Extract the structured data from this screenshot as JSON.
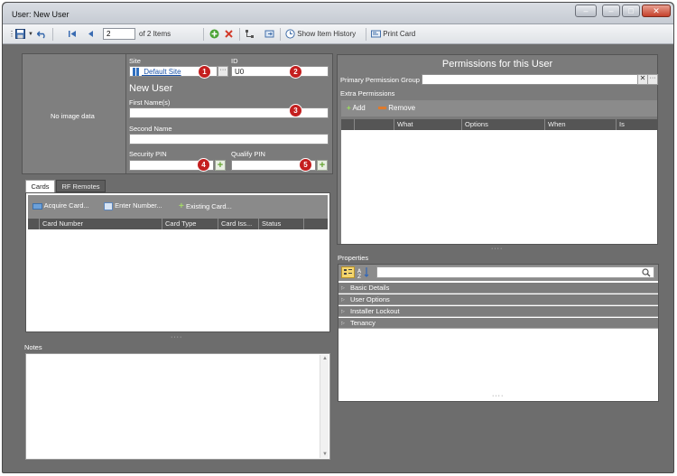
{
  "window": {
    "title": "User: New User",
    "minimize": "–",
    "maximize": "□",
    "close": "✕"
  },
  "toolbar": {
    "save_icon": "save-icon",
    "undo_icon": "undo-icon",
    "first_icon": "first-record-icon",
    "prev_icon": "previous-record-icon",
    "record_number": "2",
    "of_items": "of 2 Items",
    "add_icon": "add-icon",
    "delete_icon": "delete-icon",
    "history_label": "Show Item History",
    "print_label": "Print Card"
  },
  "photo": {
    "placeholder": "No image data"
  },
  "site": {
    "label": "Site",
    "value": "Default Site",
    "browse": "···"
  },
  "id_field": {
    "label": "ID",
    "value": "U0"
  },
  "header_name": "New User",
  "first_name": {
    "label": "First Name(s)",
    "value": ""
  },
  "second_name": {
    "label": "Second Name",
    "value": ""
  },
  "security_pin": {
    "label": "Security PIN",
    "value": ""
  },
  "qualify_pin": {
    "label": "Qualify PIN",
    "value": ""
  },
  "callouts": [
    "1",
    "2",
    "3",
    "4",
    "5"
  ],
  "tabs": [
    "Cards",
    "RF Remotes"
  ],
  "cards": {
    "acquire": "Acquire Card...",
    "enter_number": "Enter Number...",
    "existing": "Existing Card...",
    "columns": [
      "Card Number",
      "Card Type",
      "Card Iss...",
      "Status"
    ]
  },
  "notes": {
    "label": "Notes"
  },
  "permissions": {
    "title": "Permissions for this User",
    "primary_label": "Primary Permission Group",
    "primary_clear": "✕",
    "primary_browse": "···",
    "extra_label": "Extra Permissions",
    "add": "Add",
    "remove": "Remove",
    "columns": [
      "What",
      "Options",
      "When",
      "Is"
    ]
  },
  "properties": {
    "label": "Properties",
    "search_icon": "magnifier-icon",
    "groups": [
      "Basic Details",
      "User Options",
      "Installer Lockout",
      "Tenancy"
    ]
  },
  "colors": {
    "callout": "#c41f1f",
    "panel": "#7b7b7b",
    "add_green": "#66a631",
    "remove_orange": "#e07a2b"
  }
}
